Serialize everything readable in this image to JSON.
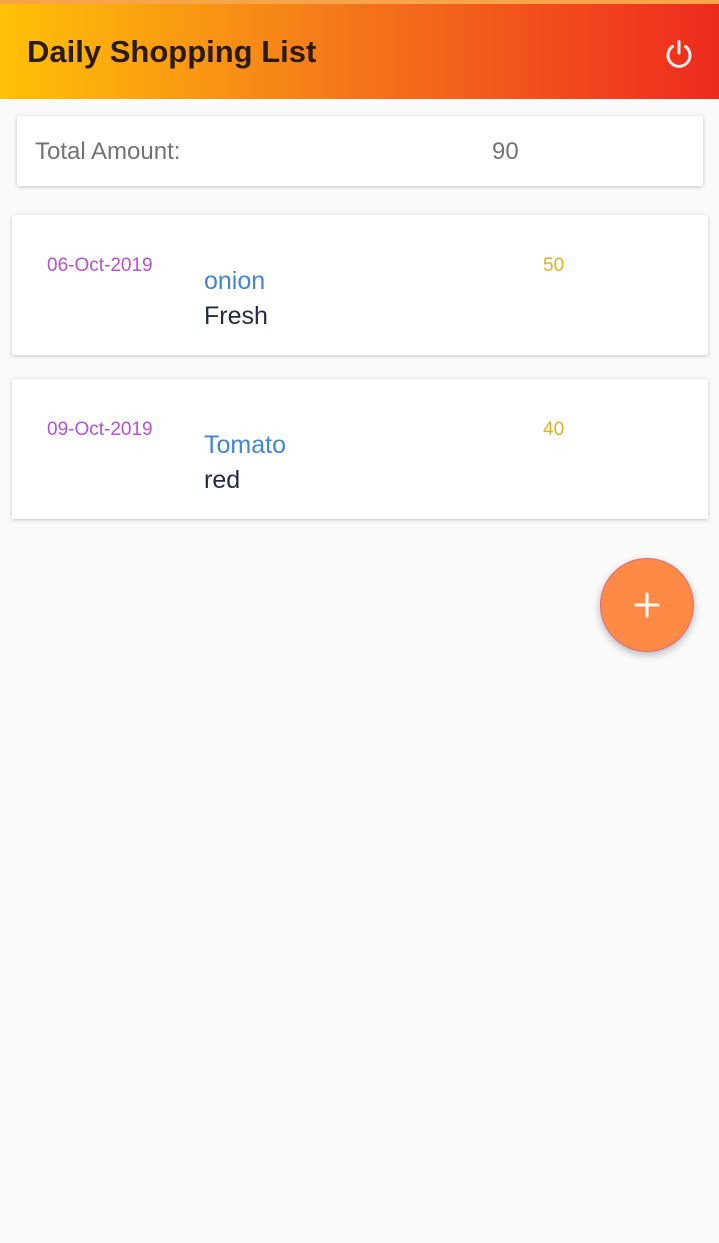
{
  "app_bar": {
    "title": "Daily Shopping List",
    "action_icon": "power-icon",
    "gradient": [
      "#ffc107",
      "#f57c1a",
      "#ee2a1e"
    ]
  },
  "summary": {
    "label": "Total Amount:",
    "value": "90"
  },
  "items": [
    {
      "date": "06-Oct-2019",
      "name": "onion",
      "description": "Fresh",
      "amount": "50"
    },
    {
      "date": "09-Oct-2019",
      "name": "Tomato",
      "description": "red",
      "amount": "40"
    }
  ],
  "fab": {
    "icon": "plus-icon",
    "color": "#ff8a45"
  },
  "colors": {
    "date": "#b650d6",
    "name": "#3f86d8",
    "amount": "#e0b21a",
    "description": "#1f2a44"
  }
}
